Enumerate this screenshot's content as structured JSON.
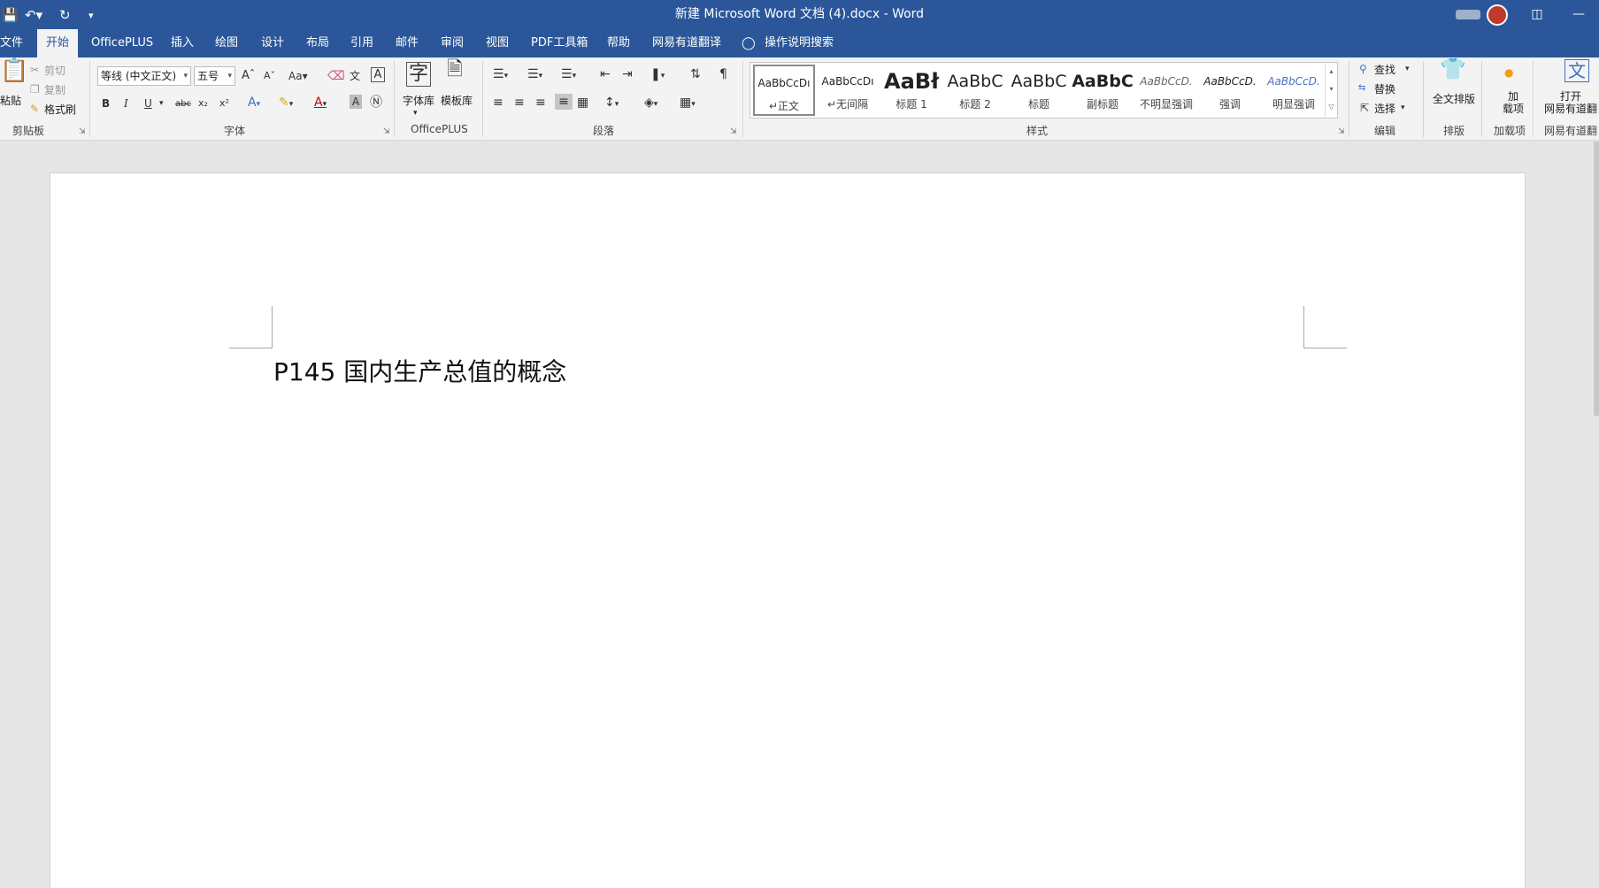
{
  "window": {
    "title": "新建 Microsoft Word 文档 (4).docx  -  Word",
    "quick_access": [
      "save-icon",
      "undo-icon",
      "redo-icon",
      "customize-icon"
    ],
    "win_controls": [
      "restore-icon",
      "minimize-icon"
    ]
  },
  "menu": {
    "tabs": [
      "文件",
      "开始",
      "OfficePLUS",
      "插入",
      "绘图",
      "设计",
      "布局",
      "引用",
      "邮件",
      "审阅",
      "视图",
      "PDF工具箱",
      "帮助",
      "网易有道翻译"
    ],
    "active_tab": "开始",
    "search_label": "操作说明搜索"
  },
  "ribbon": {
    "clipboard": {
      "label": "剪贴板",
      "paste": "粘贴",
      "cut": "剪切",
      "copy": "复制",
      "format_painter": "格式刷"
    },
    "font": {
      "label": "字体",
      "font_name": "等线 (中文正文)",
      "font_size": "五号",
      "change_case": "Aa",
      "bold": "B",
      "italic": "I",
      "underline": "U",
      "strike": "abc",
      "sub": "x₂",
      "sup": "x²"
    },
    "officeplus": {
      "label": "OfficePLUS",
      "font_lib": "字体库",
      "template_lib": "模板库"
    },
    "paragraph": {
      "label": "段落"
    },
    "styles": {
      "label": "样式",
      "items": [
        {
          "sample": "AaBbCcDı",
          "name": "正文"
        },
        {
          "sample": "AaBbCcDı",
          "name": "无间隔"
        },
        {
          "sample": "AaBł",
          "name": "标题 1"
        },
        {
          "sample": "AaBbC",
          "name": "标题 2"
        },
        {
          "sample": "AaBbC",
          "name": "标题"
        },
        {
          "sample": "AaBbC",
          "name": "副标题"
        },
        {
          "sample": "AaBbCcD.",
          "name": "不明显强调"
        },
        {
          "sample": "AaBbCcD.",
          "name": "强调"
        },
        {
          "sample": "AaBbCcD.",
          "name": "明显强调"
        }
      ]
    },
    "editing": {
      "label": "编辑",
      "find": "查找",
      "replace": "替换",
      "select": "选择"
    },
    "layout": {
      "label": "排版",
      "full_layout": "全文排版"
    },
    "addins": {
      "label": "加载项",
      "btn": "加\n载项"
    },
    "youdao": {
      "label": "网易有道翻",
      "btn": "打开\n网易有道翻"
    }
  },
  "document": {
    "heading": "P145 国内生产总值的概念"
  },
  "colors": {
    "title_bar": "#2b579a",
    "ribbon": "#f3f3f3",
    "canvas": "#e6e6e6"
  }
}
